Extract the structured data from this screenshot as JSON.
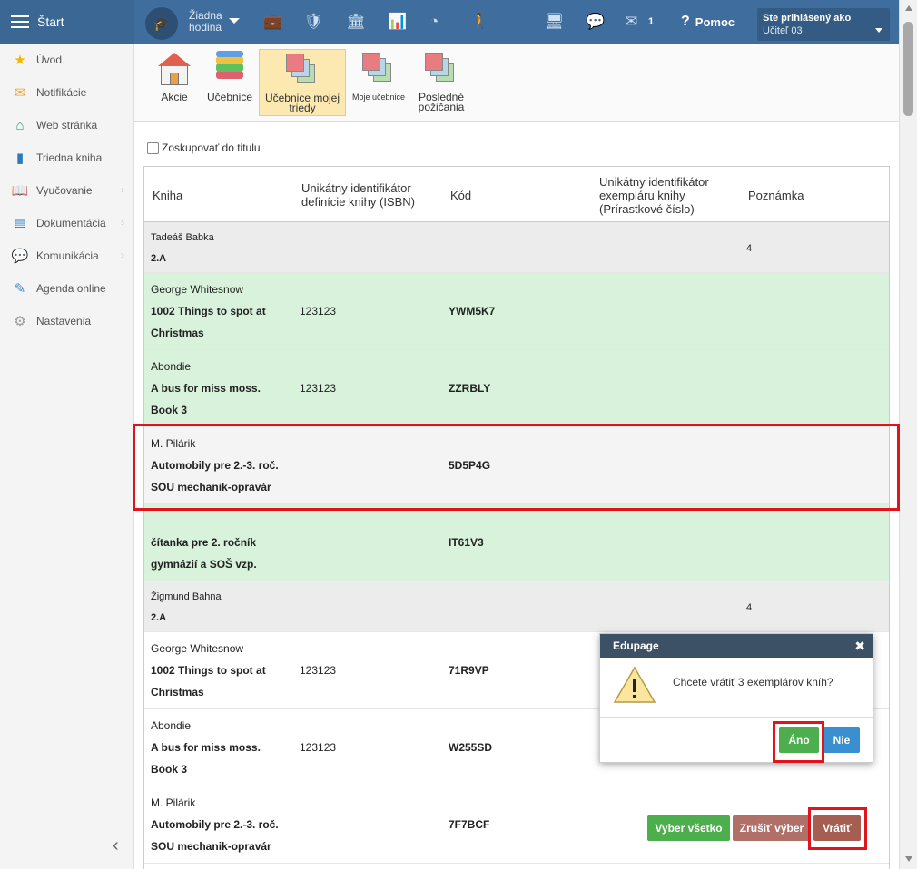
{
  "topbar": {
    "start_label": "Štart",
    "lesson_line1": "Žiadna",
    "lesson_line2": "hodina",
    "message_count": "1",
    "help_label": "Pomoc",
    "logged_in_label": "Ste prihlásený ako",
    "user_name": "Učiteľ 03"
  },
  "sidebar": {
    "items": [
      {
        "label": "Úvod",
        "icon": "star-icon",
        "color": "#f5b800",
        "chevron": false
      },
      {
        "label": "Notifikácie",
        "icon": "envelope-icon",
        "color": "#f0a030",
        "chevron": false
      },
      {
        "label": "Web stránka",
        "icon": "home-icon",
        "color": "#2e9e6a",
        "chevron": false
      },
      {
        "label": "Triedna kniha",
        "icon": "book-icon",
        "color": "#2a7bc0",
        "chevron": false
      },
      {
        "label": "Vyučovanie",
        "icon": "open-book-icon",
        "color": "#2a7bc0",
        "chevron": true
      },
      {
        "label": "Dokumentácia",
        "icon": "document-icon",
        "color": "#2a7bc0",
        "chevron": true
      },
      {
        "label": "Komunikácia",
        "icon": "chat-icon",
        "color": "#d84a3a",
        "chevron": true
      },
      {
        "label": "Agenda online",
        "icon": "pen-icon",
        "color": "#3a8fd0",
        "chevron": false
      },
      {
        "label": "Nastavenia",
        "icon": "gear-icon",
        "color": "#999999",
        "chevron": false
      }
    ]
  },
  "toolbar": {
    "akcie": "Akcie",
    "ucebnice": "Učebnice",
    "ucebnice_triedy_1": "Učebnice mojej",
    "ucebnice_triedy_2": "triedy",
    "moje_ucebnice": "Moje učebnice",
    "posledne_1": "Posledné",
    "posledne_2": "požičania"
  },
  "group_checkbox_label": "Zoskupovať do titulu",
  "table": {
    "headers": {
      "kniha": "Kniha",
      "isbn_1": "Unikátny identifikátor",
      "isbn_2": "definície knihy (ISBN)",
      "kod": "Kód",
      "exemplar_1": "Unikátny identifikátor",
      "exemplar_2": "exempláru knihy",
      "exemplar_3": "(Prírastkové číslo)",
      "poznamka": "Poznámka"
    },
    "group1": {
      "name": "Tadeáš Babka",
      "class": "2.A",
      "count": "4"
    },
    "g1_rows": [
      {
        "author": "George Whitesnow",
        "title1": "1002 Things to spot at",
        "title2": "Christmas",
        "isbn": "123123",
        "code": "YWM5K7"
      },
      {
        "author": "Abondie",
        "title1": "A bus for miss moss.",
        "title2": "Book 3",
        "isbn": "123123",
        "code": "ZZRBLY"
      },
      {
        "author": "M. Pilárik",
        "title1": "Automobily pre 2.-3. roč.",
        "title2": "SOU mechanik-opravár",
        "isbn": "",
        "code": "5D5P4G"
      },
      {
        "author": "",
        "title1": "čítanka pre 2. ročník",
        "title2": "gymnázií a SOŠ vzp.",
        "isbn": "",
        "code": "IT61V3"
      }
    ],
    "group2": {
      "name": "Žigmund Bahna",
      "class": "2.A",
      "count": "4"
    },
    "g2_rows": [
      {
        "author": "George Whitesnow",
        "title1": "1002 Things to spot at",
        "title2": "Christmas",
        "isbn": "123123",
        "code": "71R9VP"
      },
      {
        "author": "Abondie",
        "title1": "A bus for miss moss.",
        "title2": "Book 3",
        "isbn": "123123",
        "code": "W255SD"
      },
      {
        "author": "M. Pilárik",
        "title1": "Automobily pre 2.-3. roč.",
        "title2": "SOU mechanik-opravár",
        "isbn": "",
        "code": "7F7BCF"
      }
    ]
  },
  "actions": {
    "select_all": "Vyber všetko",
    "cancel_selection": "Zrušiť výber",
    "return": "Vrátiť"
  },
  "dialog": {
    "title": "Edupage",
    "message": "Chcete vrátiť 3 exemplárov kníh?",
    "yes": "Áno",
    "no": "Nie"
  }
}
